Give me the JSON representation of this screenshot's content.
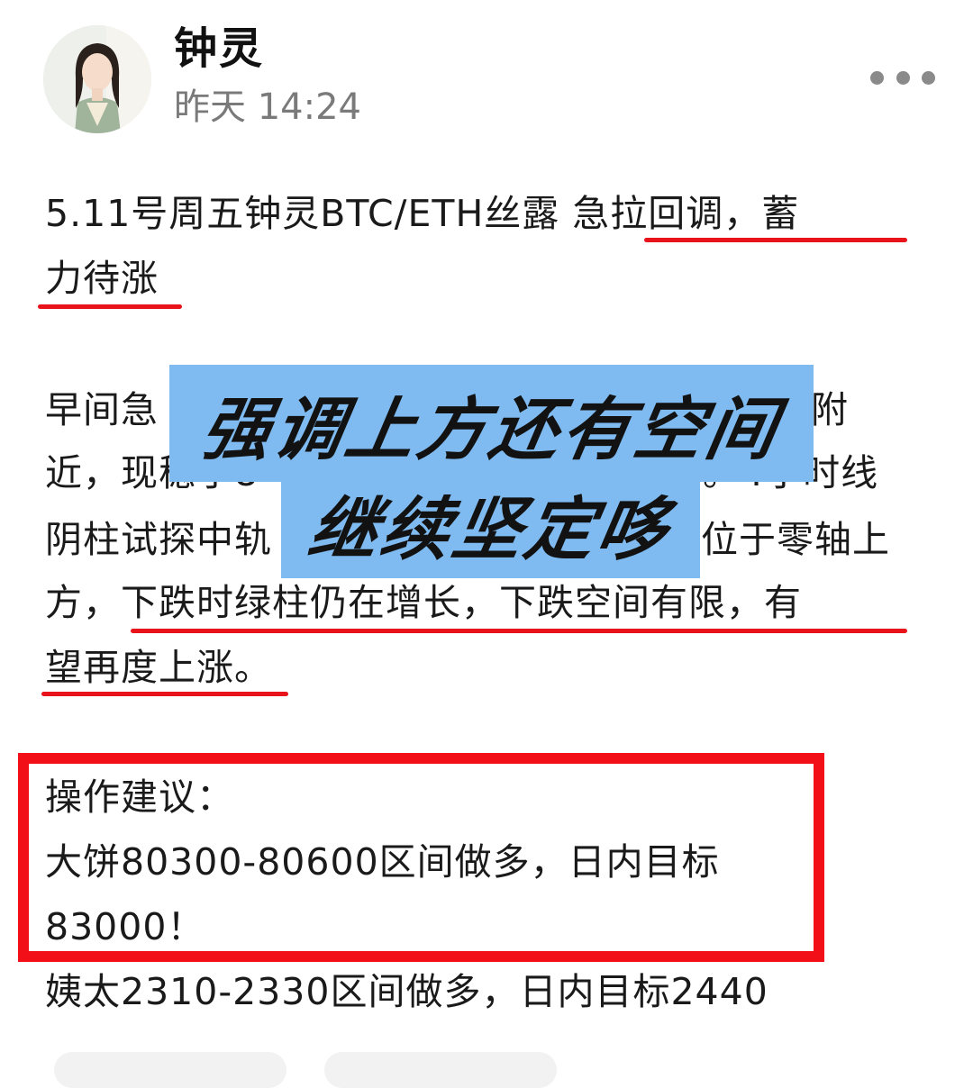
{
  "post": {
    "author": "钟灵",
    "time": "昨天 14:24",
    "title_line1": "5.11号周五钟灵BTC/ETH丝露  急拉回调，蓄",
    "title_line2": "力待涨",
    "body_lines": [
      "早间急",
      "附",
      "近，现稳于8",
      "。4小时线",
      "阴柱试探中轨",
      "位于零轴上",
      "方，下跌时绿柱仍在增长，下跌空间有限，有",
      "望再度上涨。"
    ],
    "banner_line1": "强调上方还有空间",
    "banner_line2": "继续坚定哆",
    "advice_title": "操作建议：",
    "advice_btc_line1": "大饼80300-80600区间做多，日内目标",
    "advice_btc_line2": "83000！",
    "advice_eth": "姨太2310-2330区间做多，日内目标2440"
  },
  "colors": {
    "underline": "#e8131b",
    "box_border": "#f20f17",
    "banner_bg": "#7fbbf0"
  },
  "icons": {
    "more": "more-icon"
  }
}
